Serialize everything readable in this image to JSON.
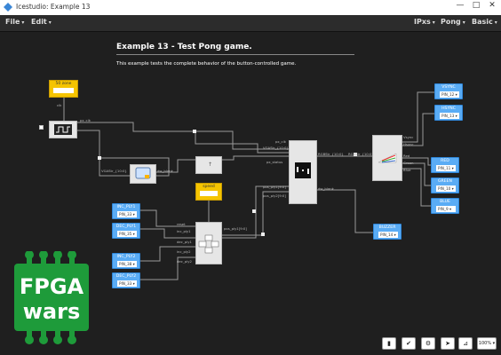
{
  "window": {
    "title": "Icestudio: Example 13",
    "controls": [
      "—",
      "□",
      "✕"
    ]
  },
  "menubar": {
    "left": [
      {
        "label": "File"
      },
      {
        "label": "Edit"
      }
    ],
    "right": [
      {
        "label": "IPxs"
      },
      {
        "label": "Pong"
      },
      {
        "label": "Basic"
      }
    ]
  },
  "project": {
    "heading": "Example 13 - Test Pong game.",
    "description": "This example tests the complete behavior of the button-controlled game."
  },
  "constants": [
    {
      "name": "50 zone",
      "value": ""
    },
    {
      "name": "speed",
      "value": ""
    }
  ],
  "inputs": [
    {
      "name": "INC_PLY1",
      "pin": "PIN_33 ▾"
    },
    {
      "name": "DEC_PLY1",
      "pin": "PIN_35 ▾"
    },
    {
      "name": "INC_PLY2",
      "pin": "PIN_38 ▾"
    },
    {
      "name": "DEC_PLY2",
      "pin": "PIN_33 ▾"
    }
  ],
  "outputs": [
    {
      "name": "VSYNC",
      "pin": "PIN_12 ▾"
    },
    {
      "name": "HSYNC",
      "pin": "PIN_13 ▾"
    },
    {
      "name": "RED",
      "pin": "PIN_11 ▾"
    },
    {
      "name": "GREEN",
      "pin": "PIN_10 ▾"
    },
    {
      "name": "BLUE",
      "pin": "PIN_9 ▾"
    },
    {
      "name": "BUZZER",
      "pin": "PIN_14 ▾"
    }
  ],
  "wire_labels": {
    "px_clk": "px_clk",
    "px_clk2": "px_clk",
    "px_x": "px_x",
    "px_y": "px_y",
    "vga_str": "VGAStr_{10:0}",
    "rgb_str": "RGBStr_{10:0}",
    "rgb_str2": "RGBStr_{10:0}",
    "px_status": "px_status",
    "px_ply_pos1": "pos_ply1[9:0]",
    "px_ply_pos2": "pos_ply2[9:0]",
    "clk": "clk",
    "inc": "inc_ply1",
    "dec": "dec_ply1",
    "inc2": "inc_ply2",
    "dec2": "dec_ply2",
    "vsync": "Vsync",
    "hsync": "Hsync",
    "red": "Red",
    "green": "Green",
    "blue": "Blue",
    "reset": "reset",
    "clk_60": "clk60_i",
    "dw_blank": "dw_blank",
    "pos_out": "pos_ply1[9:0]"
  },
  "logo": {
    "line1": "FPGA",
    "line2": "wars"
  },
  "toolbar": [
    "verify-icon",
    "check-icon",
    "gear-icon",
    "upload-icon",
    "build-icon",
    "zoom-icon"
  ],
  "toolbar_labels": [
    "▮",
    "✔",
    "⚙",
    "➤",
    "⊿",
    "100% ▾"
  ],
  "colors": {
    "background": "#1f1f1f",
    "io_blue": "#5aacf5",
    "const_yellow": "#f5c400",
    "logo_green": "#1e9b3a"
  }
}
